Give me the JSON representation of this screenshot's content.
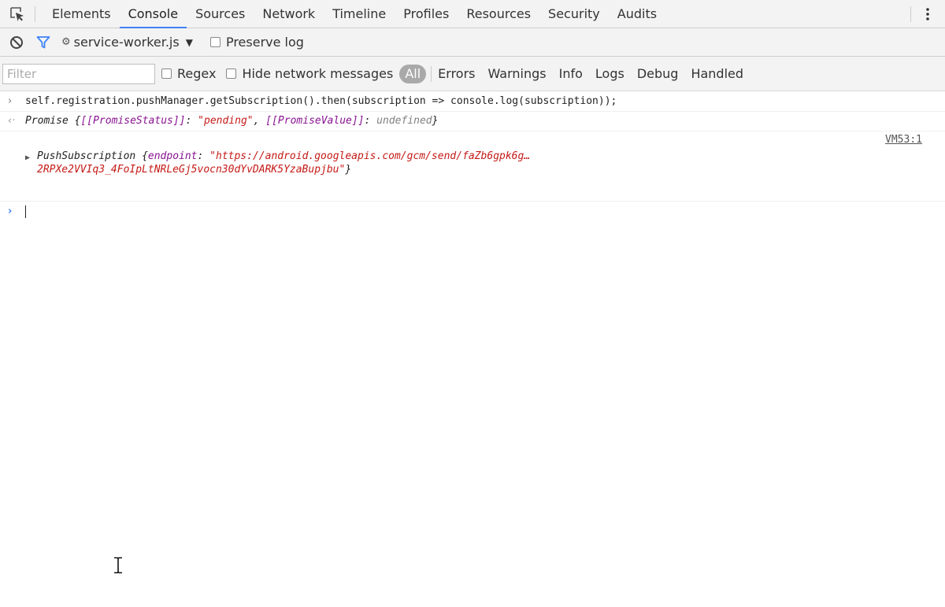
{
  "tabs": [
    {
      "label": "Elements"
    },
    {
      "label": "Console",
      "selected": true
    },
    {
      "label": "Sources"
    },
    {
      "label": "Network"
    },
    {
      "label": "Timeline"
    },
    {
      "label": "Profiles"
    },
    {
      "label": "Resources"
    },
    {
      "label": "Security"
    },
    {
      "label": "Audits"
    }
  ],
  "toolbar": {
    "context_label": "service-worker.js",
    "preserve_log_label": "Preserve log"
  },
  "filterbar": {
    "filter_placeholder": "Filter",
    "regex_label": "Regex",
    "hide_network_label": "Hide network messages",
    "levels": [
      "All",
      "Errors",
      "Warnings",
      "Info",
      "Logs",
      "Debug",
      "Handled"
    ]
  },
  "console": {
    "command": "self.registration.pushManager.getSubscription().then(subscription => console.log(subscription));",
    "result": {
      "type": "Promise",
      "status_key": "[[PromiseStatus]]",
      "status_value": "\"pending\"",
      "value_key": "[[PromiseValue]]",
      "value_value": "undefined"
    },
    "log": {
      "source": "VM53:1",
      "object_type": "PushSubscription",
      "prop_key": "endpoint",
      "value_line1": "\"https://android.googleapis.com/gcm/send/faZb6gpk6g…",
      "value_line2": "2RPXe2VVIq3_4FoIpLtNRLeGj5vocn30dYvDARK5YzaBupjbu\""
    }
  },
  "colors": {
    "accent": "#3e82f7",
    "property": "#881391",
    "string": "#c41a16",
    "undefined": "#808080"
  }
}
